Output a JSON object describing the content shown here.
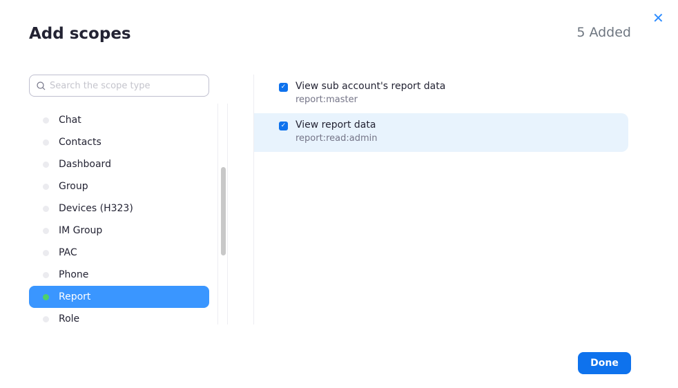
{
  "header": {
    "title": "Add scopes",
    "added_count": "5 Added",
    "close": "✕"
  },
  "search": {
    "placeholder": "Search the scope type"
  },
  "categories": [
    {
      "label": "Chat",
      "active": false
    },
    {
      "label": "Contacts",
      "active": false
    },
    {
      "label": "Dashboard",
      "active": false
    },
    {
      "label": "Group",
      "active": false
    },
    {
      "label": "Devices (H323)",
      "active": false
    },
    {
      "label": "IM Group",
      "active": false
    },
    {
      "label": "PAC",
      "active": false
    },
    {
      "label": "Phone",
      "active": false
    },
    {
      "label": "Report",
      "active": true
    },
    {
      "label": "Role",
      "active": false
    }
  ],
  "scopes": [
    {
      "name": "View sub account's report data",
      "code": "report:master",
      "checked": true
    },
    {
      "name": "View report data",
      "code": "report:read:admin",
      "checked": true
    }
  ],
  "footer": {
    "done": "Done"
  }
}
